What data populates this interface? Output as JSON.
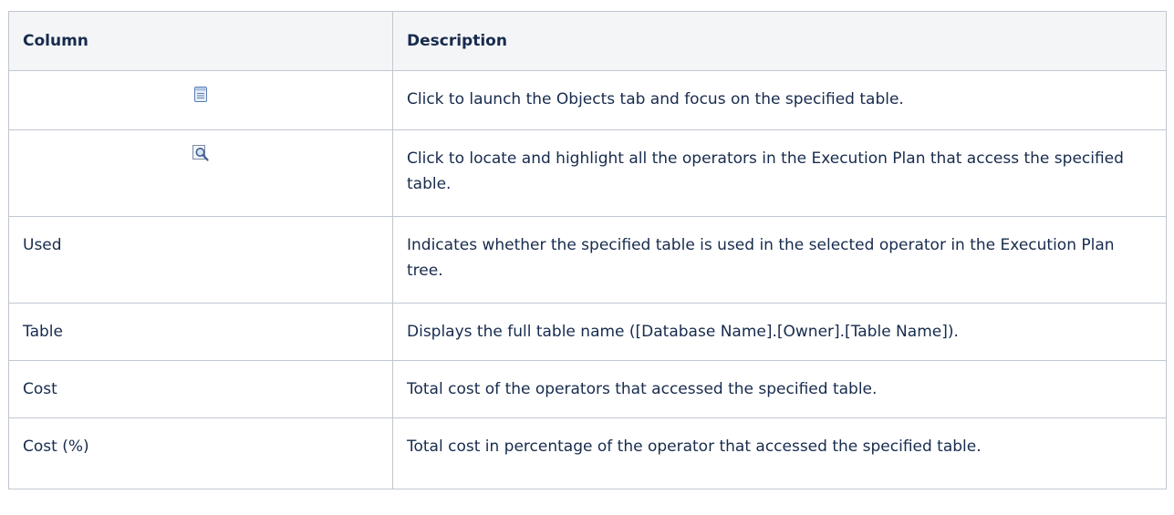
{
  "table": {
    "headers": [
      "Column",
      "Description"
    ],
    "rows": [
      {
        "column": "",
        "icon": "object-page-icon",
        "description": "Click to launch the Objects tab and focus on the specified table."
      },
      {
        "column": "",
        "icon": "locate-magnifier-icon",
        "description": "Click to locate and highlight all the operators in the Execution Plan that access the specified table."
      },
      {
        "column": "Used",
        "description": "Indicates whether the specified table is used in the selected operator in the Execution Plan tree."
      },
      {
        "column": "Table",
        "description": "Displays the full table name ([Database Name].[Owner].[Table Name])."
      },
      {
        "column": "Cost",
        "description": "Total cost of the operators that accessed the specified table."
      },
      {
        "column": "Cost (%)",
        "description": "Total cost in percentage of the operator that accessed the specified table."
      }
    ]
  },
  "colors": {
    "header_bg": "#f4f5f7",
    "border": "#c1c7d0",
    "text": "#172b4d",
    "icon_blue": "#4a6fa5"
  }
}
